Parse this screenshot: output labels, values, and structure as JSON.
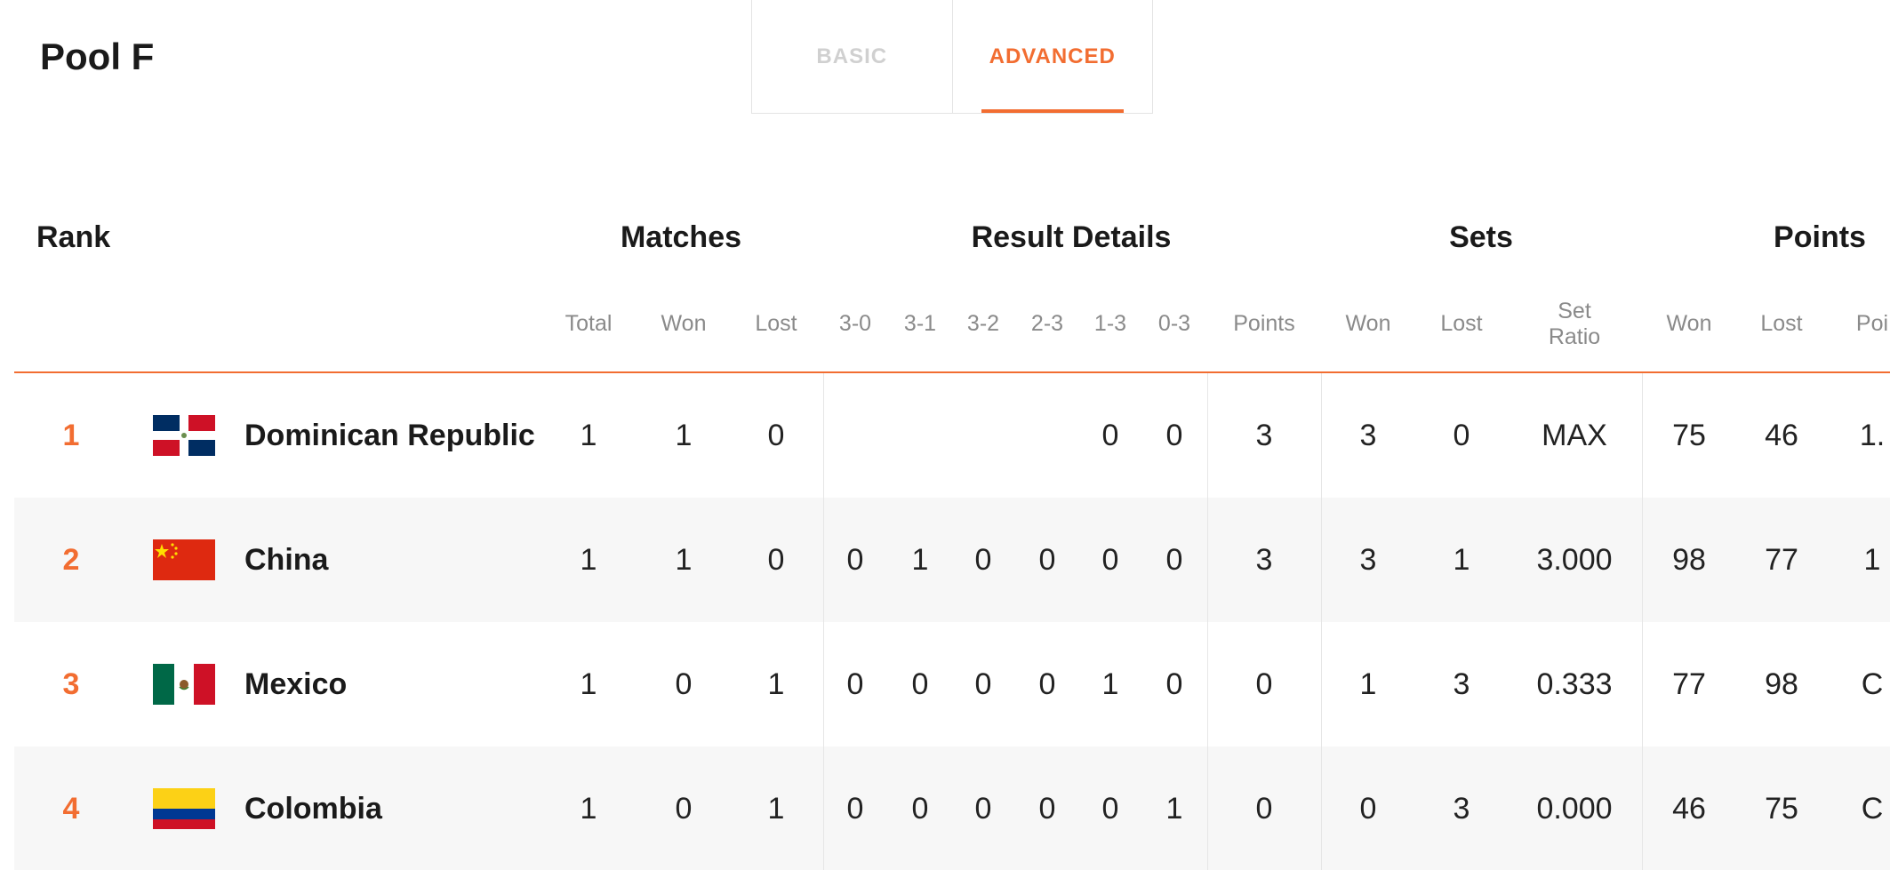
{
  "page_title": "Pool F",
  "tabs": {
    "basic": "BASIC",
    "advanced": "ADVANCED",
    "active": "advanced"
  },
  "table": {
    "groups": {
      "rank": "Rank",
      "matches": "Matches",
      "result_details": "Result Details",
      "sets": "Sets",
      "points": "Points"
    },
    "columns": {
      "total": "Total",
      "won": "Won",
      "lost": "Lost",
      "r30": "3-0",
      "r31": "3-1",
      "r32": "3-2",
      "r23": "2-3",
      "r13": "1-3",
      "r03": "0-3",
      "points": "Points",
      "sets_won": "Won",
      "sets_lost": "Lost",
      "set_ratio_line1": "Set",
      "set_ratio_line2": "Ratio",
      "pts_won": "Won",
      "pts_lost": "Lost",
      "pts_ratio": "Poi"
    },
    "rows": [
      {
        "rank": "1",
        "country": "Dominican Republic",
        "flag": "dominican-republic-flag",
        "total": "1",
        "won": "1",
        "lost": "0",
        "r30": "",
        "r31": "",
        "r32": "",
        "r23": "",
        "r13": "0",
        "r03": "0",
        "points": "3",
        "sets_won": "3",
        "sets_lost": "0",
        "set_ratio": "MAX",
        "pts_won": "75",
        "pts_lost": "46",
        "pts_ratio": "1."
      },
      {
        "rank": "2",
        "country": "China",
        "flag": "china-flag",
        "total": "1",
        "won": "1",
        "lost": "0",
        "r30": "0",
        "r31": "1",
        "r32": "0",
        "r23": "0",
        "r13": "0",
        "r03": "0",
        "points": "3",
        "sets_won": "3",
        "sets_lost": "1",
        "set_ratio": "3.000",
        "pts_won": "98",
        "pts_lost": "77",
        "pts_ratio": "1"
      },
      {
        "rank": "3",
        "country": "Mexico",
        "flag": "mexico-flag",
        "total": "1",
        "won": "0",
        "lost": "1",
        "r30": "0",
        "r31": "0",
        "r32": "0",
        "r23": "0",
        "r13": "1",
        "r03": "0",
        "points": "0",
        "sets_won": "1",
        "sets_lost": "3",
        "set_ratio": "0.333",
        "pts_won": "77",
        "pts_lost": "98",
        "pts_ratio": "C"
      },
      {
        "rank": "4",
        "country": "Colombia",
        "flag": "colombia-flag",
        "total": "1",
        "won": "0",
        "lost": "1",
        "r30": "0",
        "r31": "0",
        "r32": "0",
        "r23": "0",
        "r13": "0",
        "r03": "1",
        "points": "0",
        "sets_won": "0",
        "sets_lost": "3",
        "set_ratio": "0.000",
        "pts_won": "46",
        "pts_lost": "75",
        "pts_ratio": "C"
      }
    ]
  },
  "colors": {
    "accent": "#f26d31",
    "row_alt": "#f7f7f7",
    "muted": "#8a8a8a"
  }
}
